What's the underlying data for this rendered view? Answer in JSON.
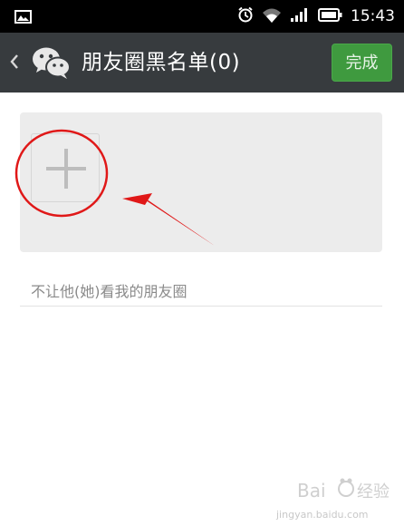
{
  "status_bar": {
    "time": "15:43",
    "icons": [
      "image-icon",
      "alarm-icon",
      "wifi-icon",
      "signal-icon",
      "battery-icon"
    ]
  },
  "header": {
    "title": "朋友圈黑名单(0)",
    "done_label": "完成",
    "accent_color": "#3f9a3f"
  },
  "main": {
    "hint": "不让他(她)看我的朋友圈"
  },
  "watermark": {
    "text": "jingyan.baidu.com"
  }
}
